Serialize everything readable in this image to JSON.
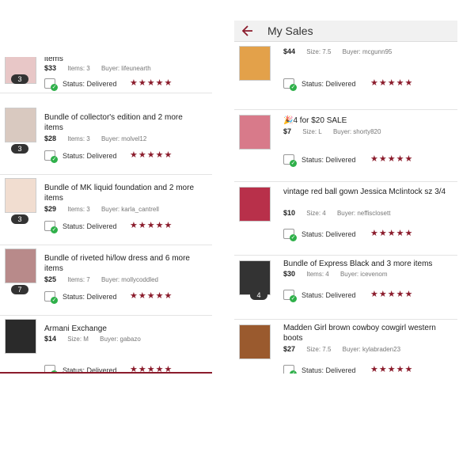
{
  "header": {
    "title": "My Sales"
  },
  "status_label": "Status: Delivered",
  "stars": "★★★★★",
  "left_items": [
    {
      "title": "items",
      "price": "$33",
      "count": "Items: 3",
      "buyer": "Buyer: lifeunearth",
      "badge": "3"
    },
    {
      "title": "Bundle of collector's edition and 2 more items",
      "price": "$28",
      "count": "Items: 3",
      "buyer": "Buyer: molvel12",
      "badge": "3"
    },
    {
      "title": "Bundle of MK liquid foundation and 2 more items",
      "price": "$29",
      "count": "Items: 3",
      "buyer": "Buyer: karla_cantrell",
      "badge": "3"
    },
    {
      "title": "Bundle of riveted hi/low dress and 6 more items",
      "price": "$25",
      "count": "Items: 7",
      "buyer": "Buyer: mollycoddled",
      "badge": "7"
    },
    {
      "title": "Armani Exchange",
      "price": "$14",
      "count": "Size: M",
      "buyer": "Buyer: gabazo",
      "badge": ""
    }
  ],
  "right_items": [
    {
      "title": "",
      "price": "$44",
      "count": "Size: 7.5",
      "buyer": "Buyer: mcgunn95",
      "badge": ""
    },
    {
      "title": "🎉4 for $20 SALE",
      "price": "$7",
      "count": "Size: L",
      "buyer": "Buyer: shorty820",
      "badge": ""
    },
    {
      "title": "vintage red ball gown Jessica McIintock sz 3/4",
      "price": "$10",
      "count": "Size: 4",
      "buyer": "Buyer: neffisclosett",
      "badge": ""
    },
    {
      "title": "Bundle of Express Black and 3 more items",
      "price": "$30",
      "count": "Items: 4",
      "buyer": "Buyer: icevenom",
      "badge": "4"
    },
    {
      "title": "Madden Girl brown cowboy cowgirl western boots",
      "price": "$27",
      "count": "Size: 7.5",
      "buyer": "Buyer: kylabraden23",
      "badge": ""
    }
  ]
}
